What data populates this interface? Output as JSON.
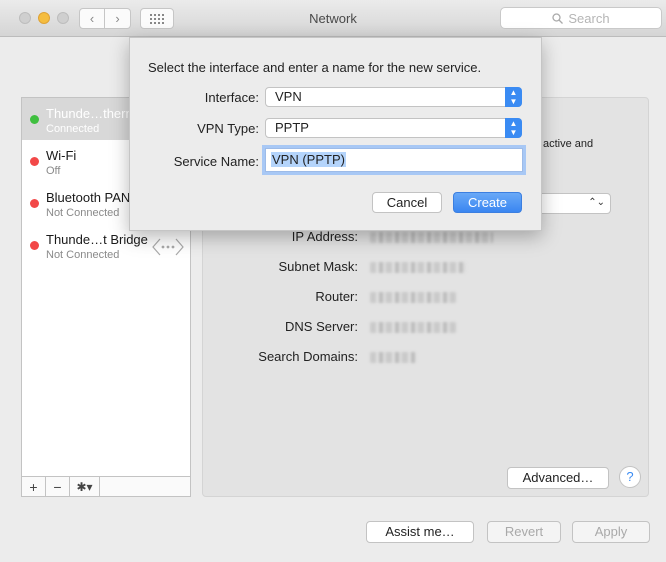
{
  "window": {
    "title": "Network",
    "search_placeholder": "Search"
  },
  "sidebar": {
    "items": [
      {
        "name": "Thunde…thern",
        "status": "Connected",
        "state": "green"
      },
      {
        "name": "Wi-Fi",
        "status": "Off",
        "state": "red"
      },
      {
        "name": "Bluetooth PAN",
        "status": "Not Connected",
        "state": "red"
      },
      {
        "name": "Thunde…t Bridge",
        "status": "Not Connected",
        "state": "red"
      }
    ],
    "toolbar": {
      "add": "+",
      "remove": "−",
      "gear": "✱▾"
    }
  },
  "detail": {
    "status_fragment": "active and",
    "rows": [
      {
        "label": "IP Address:"
      },
      {
        "label": "Subnet Mask:"
      },
      {
        "label": "Router:"
      },
      {
        "label": "DNS Server:"
      },
      {
        "label": "Search Domains:"
      }
    ],
    "advanced_label": "Advanced…",
    "help_label": "?"
  },
  "footer": {
    "assist_label": "Assist me…",
    "revert_label": "Revert",
    "apply_label": "Apply"
  },
  "sheet": {
    "prompt": "Select the interface and enter a name for the new service.",
    "interface_label": "Interface:",
    "interface_value": "VPN",
    "vpn_type_label": "VPN Type:",
    "vpn_type_value": "PPTP",
    "service_name_label": "Service Name:",
    "service_name_value": "VPN (PPTP)",
    "cancel_label": "Cancel",
    "create_label": "Create"
  },
  "colors": {
    "accent": "#3a8bf3",
    "status_green": "#3fbf3f",
    "status_red": "#f24848"
  }
}
